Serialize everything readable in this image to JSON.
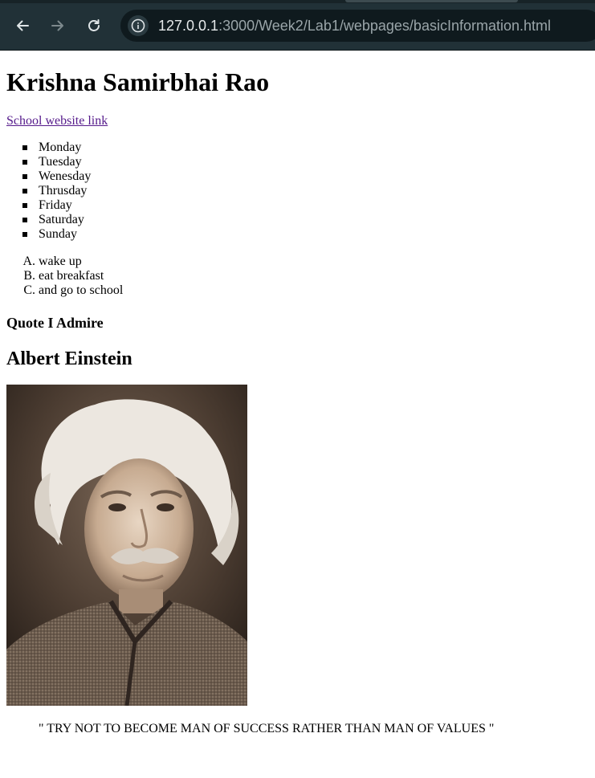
{
  "browser": {
    "url_host": "127.0.0.1",
    "url_rest": ":3000/Week2/Lab1/webpages/basicInformation.html",
    "icons": [
      "back-arrow-icon",
      "forward-arrow-icon",
      "reload-icon",
      "site-info-icon"
    ]
  },
  "page": {
    "title": "Krishna Samirbhai Rao",
    "school_link": "School website link",
    "days": [
      "Monday",
      "Tuesday",
      "Wenesday",
      "Thrusday",
      "Friday",
      "Saturday",
      "Sunday"
    ],
    "routine": [
      {
        "marker": "A.",
        "text": "wake up"
      },
      {
        "marker": "B.",
        "text": "eat breakfast"
      },
      {
        "marker": "C.",
        "text": "and go to school"
      }
    ],
    "quote_heading": "Quote I Admire",
    "person": "Albert Einstein",
    "quote": "\" TRY NOT TO BECOME MAN OF SUCCESS RATHER THAN MAN OF VALUES \"",
    "link_color": "#551a8b"
  }
}
